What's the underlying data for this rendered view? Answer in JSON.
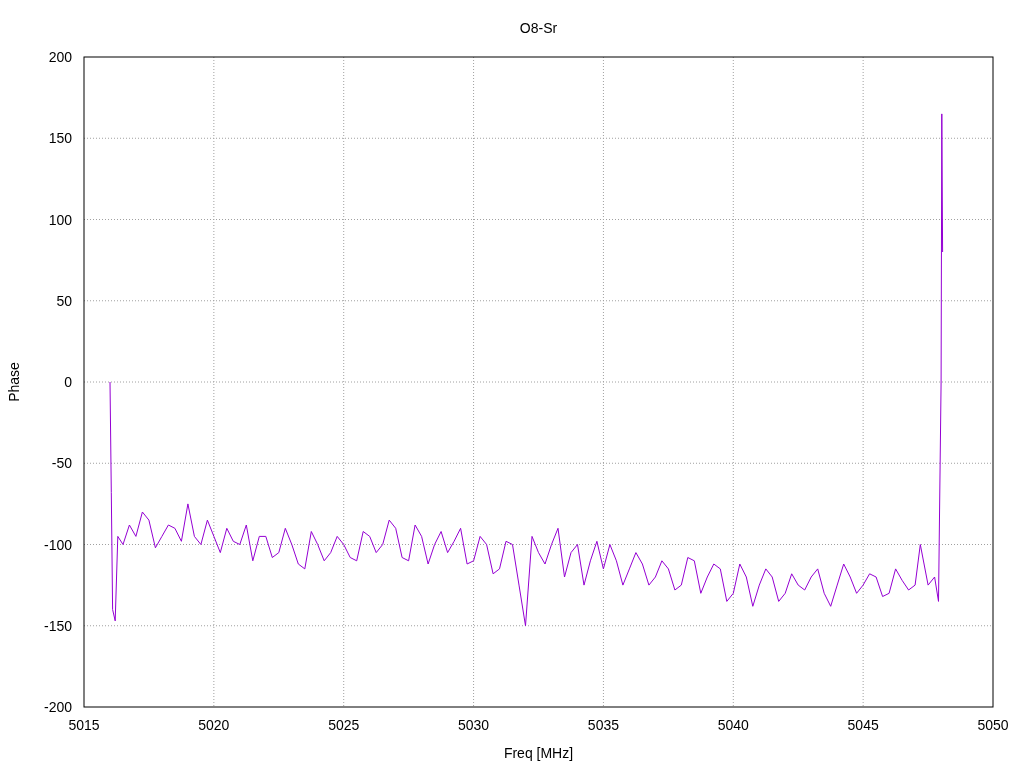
{
  "chart_data": {
    "type": "line",
    "title": "O8-Sr",
    "xlabel": "Freq [MHz]",
    "ylabel": "Phase",
    "xlim": [
      5015,
      5050
    ],
    "ylim": [
      -200,
      200
    ],
    "xticks": [
      5015,
      5020,
      5025,
      5030,
      5035,
      5040,
      5045,
      5050
    ],
    "yticks": [
      -200,
      -150,
      -100,
      -50,
      0,
      50,
      100,
      150,
      200
    ],
    "x": [
      5016,
      5016.05,
      5016.1,
      5016.2,
      5016.3,
      5016.5,
      5016.75,
      5017,
      5017.25,
      5017.5,
      5017.75,
      5018,
      5018.25,
      5018.5,
      5018.75,
      5019,
      5019.25,
      5019.5,
      5019.75,
      5020,
      5020.25,
      5020.5,
      5020.75,
      5021,
      5021.25,
      5021.5,
      5021.75,
      5022,
      5022.25,
      5022.5,
      5022.75,
      5023,
      5023.25,
      5023.5,
      5023.75,
      5024,
      5024.25,
      5024.5,
      5024.75,
      5025,
      5025.25,
      5025.5,
      5025.75,
      5026,
      5026.25,
      5026.5,
      5026.75,
      5027,
      5027.25,
      5027.5,
      5027.75,
      5028,
      5028.25,
      5028.5,
      5028.75,
      5029,
      5029.25,
      5029.5,
      5029.75,
      5030,
      5030.25,
      5030.5,
      5030.75,
      5031,
      5031.25,
      5031.5,
      5031.75,
      5032,
      5032.25,
      5032.5,
      5032.75,
      5033,
      5033.25,
      5033.5,
      5033.75,
      5034,
      5034.25,
      5034.5,
      5034.75,
      5035,
      5035.25,
      5035.5,
      5035.75,
      5036,
      5036.25,
      5036.5,
      5036.75,
      5037,
      5037.25,
      5037.5,
      5037.75,
      5038,
      5038.25,
      5038.5,
      5038.75,
      5039,
      5039.25,
      5039.5,
      5039.75,
      5040,
      5040.25,
      5040.5,
      5040.75,
      5041,
      5041.25,
      5041.5,
      5041.75,
      5042,
      5042.25,
      5042.5,
      5042.75,
      5043,
      5043.25,
      5043.5,
      5043.75,
      5044,
      5044.25,
      5044.5,
      5044.75,
      5045,
      5045.25,
      5045.5,
      5045.75,
      5046,
      5046.25,
      5046.5,
      5046.75,
      5047,
      5047.2,
      5047.5,
      5047.75,
      5047.9,
      5048,
      5048.03,
      5048.06
    ],
    "grid": true,
    "series": [
      {
        "color": "#9400d3",
        "values": [
          0,
          -68,
          -140,
          -147,
          -95,
          -100,
          -88,
          -95,
          -80,
          -85,
          -102,
          -95,
          -88,
          -90,
          -98,
          -75,
          -95,
          -100,
          -85,
          -95,
          -105,
          -90,
          -98,
          -100,
          -88,
          -110,
          -95,
          -95,
          -108,
          -105,
          -90,
          -100,
          -112,
          -115,
          -92,
          -100,
          -110,
          -105,
          -95,
          -100,
          -108,
          -110,
          -92,
          -95,
          -105,
          -100,
          -85,
          -90,
          -108,
          -110,
          -88,
          -95,
          -112,
          -100,
          -92,
          -105,
          -98,
          -90,
          -112,
          -110,
          -95,
          -100,
          -118,
          -115,
          -98,
          -100,
          -125,
          -150,
          -95,
          -105,
          -112,
          -100,
          -90,
          -120,
          -105,
          -100,
          -125,
          -110,
          -98,
          -115,
          -100,
          -110,
          -125,
          -115,
          -105,
          -112,
          -125,
          -120,
          -110,
          -115,
          -128,
          -125,
          -108,
          -110,
          -130,
          -120,
          -112,
          -115,
          -135,
          -130,
          -112,
          -120,
          -138,
          -125,
          -115,
          -120,
          -135,
          -130,
          -118,
          -125,
          -128,
          -120,
          -115,
          -130,
          -138,
          -125,
          -112,
          -120,
          -130,
          -125,
          -118,
          -120,
          -132,
          -130,
          -115,
          -122,
          -128,
          -125,
          -100,
          -125,
          -120,
          -135,
          0,
          165,
          80
        ]
      }
    ]
  }
}
